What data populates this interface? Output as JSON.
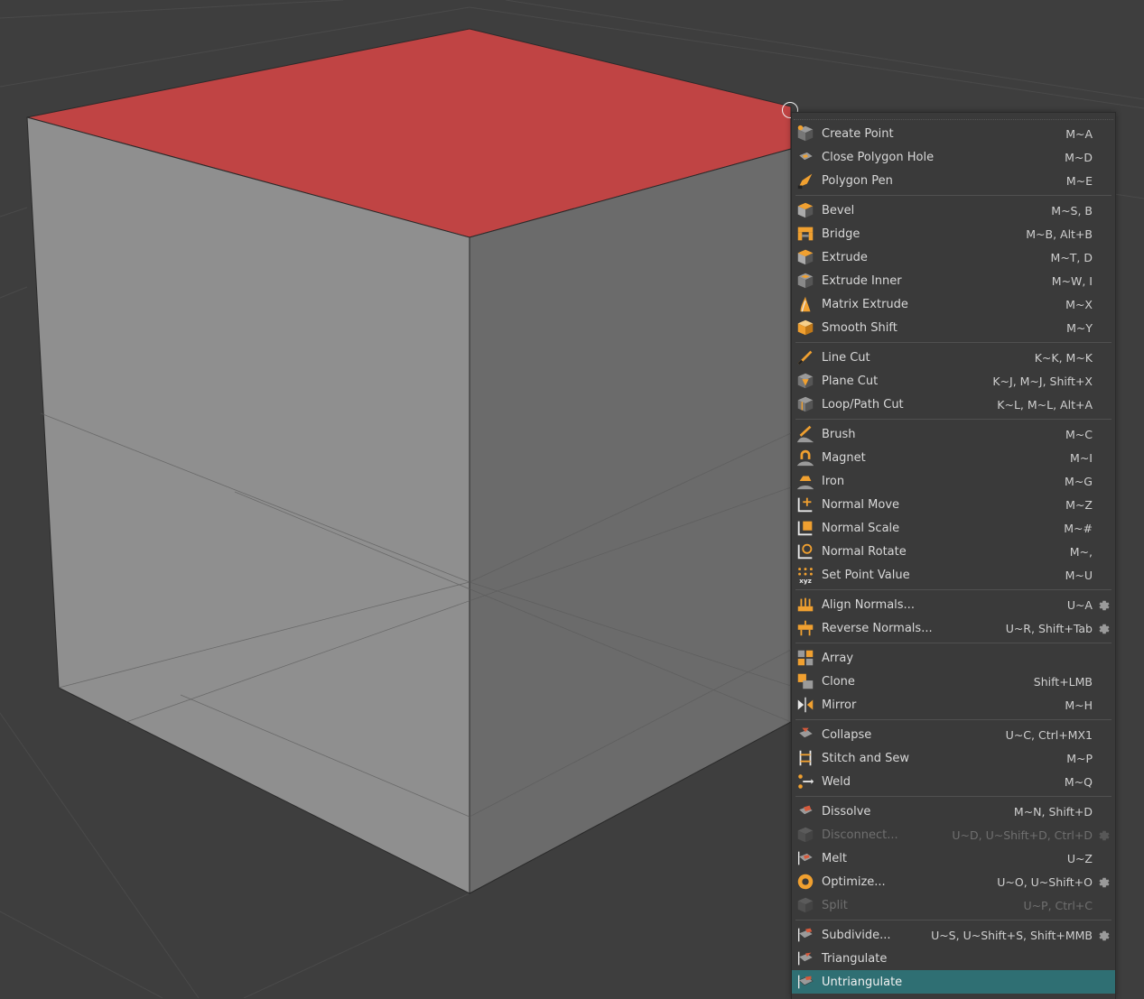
{
  "viewport": {
    "background_color": "#3e3e3e",
    "selected_face_color": "#c04444",
    "cube_front_color": "#8f8f8f",
    "cube_right_color": "#6a6a6a"
  },
  "menu": {
    "highlight_color": "#2f6f73",
    "groups": [
      [
        {
          "label": "Create Point",
          "shortcut": "M~A",
          "icon": "create-point-icon"
        },
        {
          "label": "Close Polygon Hole",
          "shortcut": "M~D",
          "icon": "close-polygon-hole-icon"
        },
        {
          "label": "Polygon Pen",
          "shortcut": "M~E",
          "icon": "polygon-pen-icon"
        }
      ],
      [
        {
          "label": "Bevel",
          "shortcut": "M~S, B",
          "icon": "bevel-icon"
        },
        {
          "label": "Bridge",
          "shortcut": "M~B, Alt+B",
          "icon": "bridge-icon"
        },
        {
          "label": "Extrude",
          "shortcut": "M~T, D",
          "icon": "extrude-icon"
        },
        {
          "label": "Extrude Inner",
          "shortcut": "M~W, I",
          "icon": "extrude-inner-icon"
        },
        {
          "label": "Matrix Extrude",
          "shortcut": "M~X",
          "icon": "matrix-extrude-icon"
        },
        {
          "label": "Smooth Shift",
          "shortcut": "M~Y",
          "icon": "smooth-shift-icon"
        }
      ],
      [
        {
          "label": "Line Cut",
          "shortcut": "K~K, M~K",
          "icon": "line-cut-icon"
        },
        {
          "label": "Plane Cut",
          "shortcut": "K~J, M~J, Shift+X",
          "icon": "plane-cut-icon"
        },
        {
          "label": "Loop/Path Cut",
          "shortcut": "K~L, M~L, Alt+A",
          "icon": "loop-path-cut-icon"
        }
      ],
      [
        {
          "label": "Brush",
          "shortcut": "M~C",
          "icon": "brush-icon"
        },
        {
          "label": "Magnet",
          "shortcut": "M~I",
          "icon": "magnet-icon"
        },
        {
          "label": "Iron",
          "shortcut": "M~G",
          "icon": "iron-icon"
        },
        {
          "label": "Normal Move",
          "shortcut": "M~Z",
          "icon": "normal-move-icon"
        },
        {
          "label": "Normal Scale",
          "shortcut": "M~#",
          "icon": "normal-scale-icon"
        },
        {
          "label": "Normal Rotate",
          "shortcut": "M~,",
          "icon": "normal-rotate-icon"
        },
        {
          "label": "Set Point Value",
          "shortcut": "M~U",
          "icon": "set-point-value-icon"
        }
      ],
      [
        {
          "label": "Align Normals...",
          "shortcut": "U~A",
          "icon": "align-normals-icon",
          "gear": true
        },
        {
          "label": "Reverse Normals...",
          "shortcut": "U~R, Shift+Tab",
          "icon": "reverse-normals-icon",
          "gear": true
        }
      ],
      [
        {
          "label": "Array",
          "shortcut": "",
          "icon": "array-icon"
        },
        {
          "label": "Clone",
          "shortcut": "Shift+LMB",
          "icon": "clone-icon"
        },
        {
          "label": "Mirror",
          "shortcut": "M~H",
          "icon": "mirror-icon"
        }
      ],
      [
        {
          "label": "Collapse",
          "shortcut": "U~C, Ctrl+MX1",
          "icon": "collapse-icon"
        },
        {
          "label": "Stitch and Sew",
          "shortcut": "M~P",
          "icon": "stitch-and-sew-icon"
        },
        {
          "label": "Weld",
          "shortcut": "M~Q",
          "icon": "weld-icon"
        }
      ],
      [
        {
          "label": "Dissolve",
          "shortcut": "M~N, Shift+D",
          "icon": "dissolve-icon"
        },
        {
          "label": "Disconnect...",
          "shortcut": "U~D, U~Shift+D, Ctrl+D",
          "icon": "disconnect-icon",
          "gear": true,
          "disabled": true
        },
        {
          "label": "Melt",
          "shortcut": "U~Z",
          "icon": "melt-icon"
        },
        {
          "label": "Optimize...",
          "shortcut": "U~O, U~Shift+O",
          "icon": "optimize-icon",
          "gear": true
        },
        {
          "label": "Split",
          "shortcut": "U~P, Ctrl+C",
          "icon": "split-icon",
          "disabled": true
        }
      ],
      [
        {
          "label": "Subdivide...",
          "shortcut": "U~S, U~Shift+S, Shift+MMB",
          "icon": "subdivide-icon",
          "gear": true
        },
        {
          "label": "Triangulate",
          "shortcut": "",
          "icon": "triangulate-icon"
        },
        {
          "label": "Untriangulate",
          "shortcut": "",
          "icon": "untriangulate-icon",
          "highlighted": true
        }
      ]
    ]
  }
}
